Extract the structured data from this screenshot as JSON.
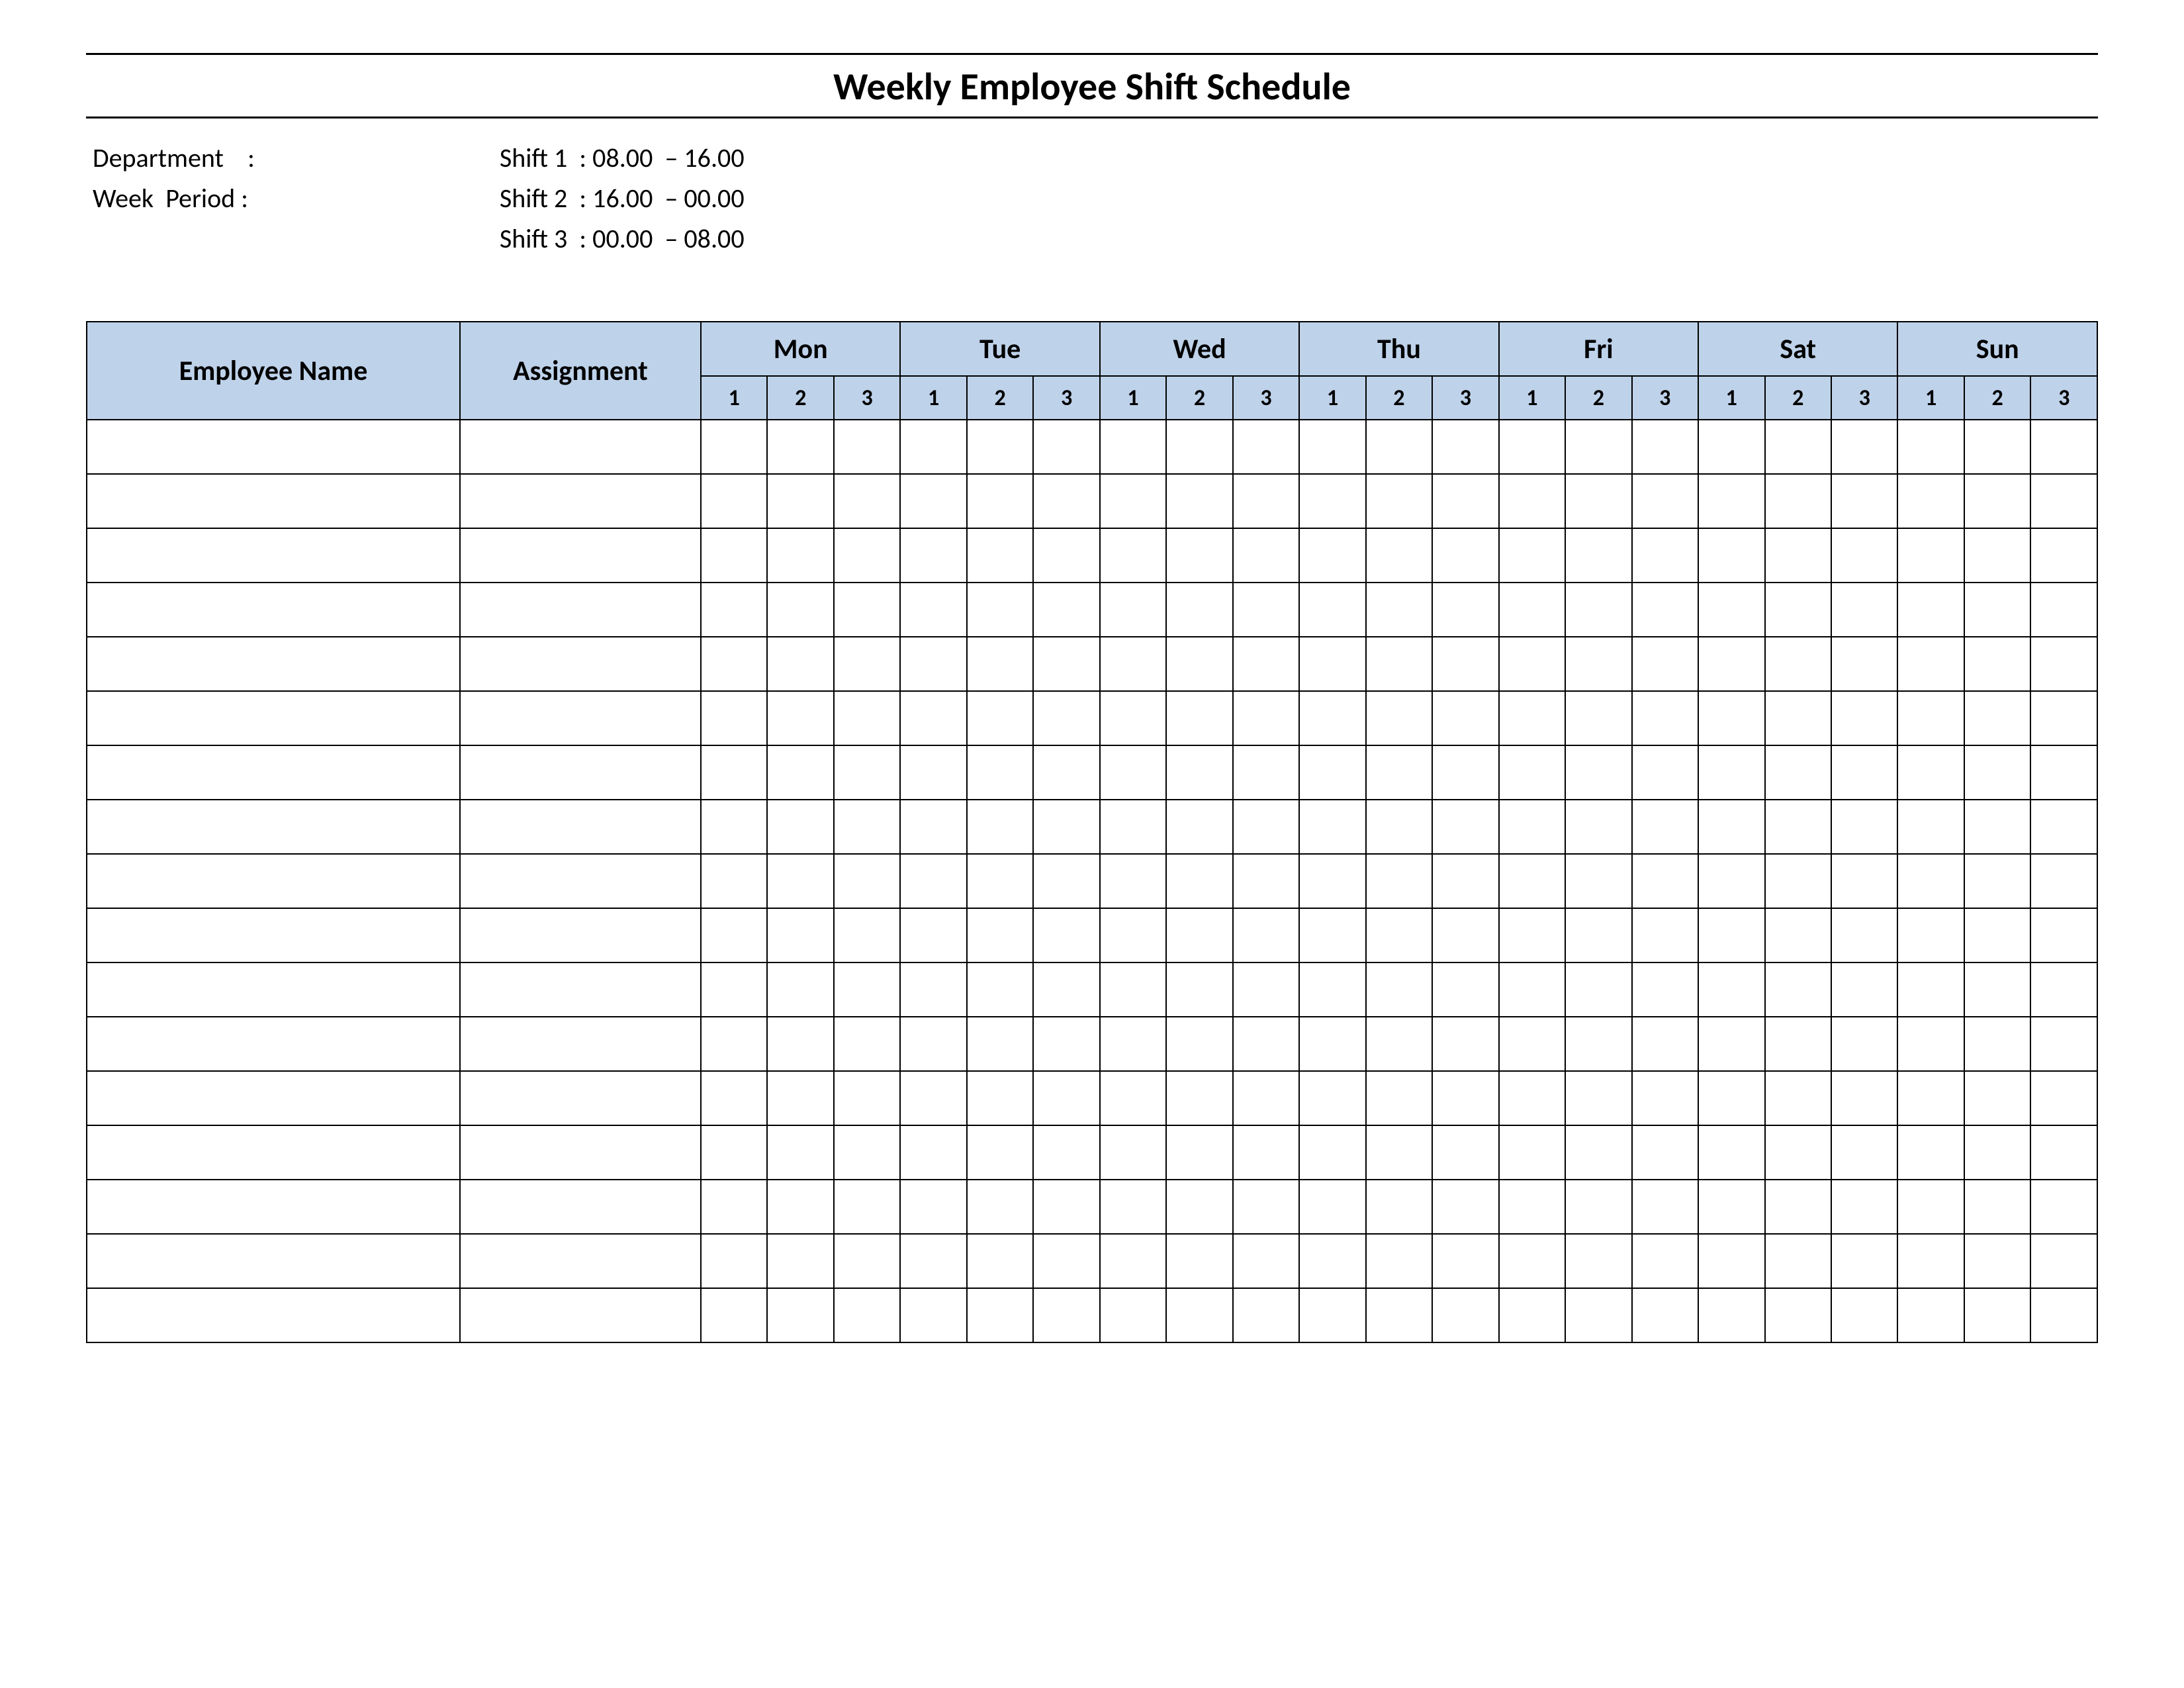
{
  "title": "Weekly Employee Shift Schedule",
  "meta": {
    "left": {
      "department_label": "Department    :",
      "department_value": "",
      "week_period_label": "Week  Period :",
      "week_period_value": ""
    },
    "right": {
      "shift1": "Shift 1  : 08.00  – 16.00",
      "shift2": "Shift 2  : 16.00  – 00.00",
      "shift3": "Shift 3  : 00.00  – 08.00"
    }
  },
  "headers": {
    "employee_name": "Employee Name",
    "assignment": "Assignment",
    "days": [
      "Mon",
      "Tue",
      "Wed",
      "Thu",
      "Fri",
      "Sat",
      "Sun"
    ],
    "shifts": [
      "1",
      "2",
      "3"
    ]
  },
  "row_count": 17,
  "colors": {
    "header_bg": "#bed2ea",
    "border": "#000000"
  }
}
